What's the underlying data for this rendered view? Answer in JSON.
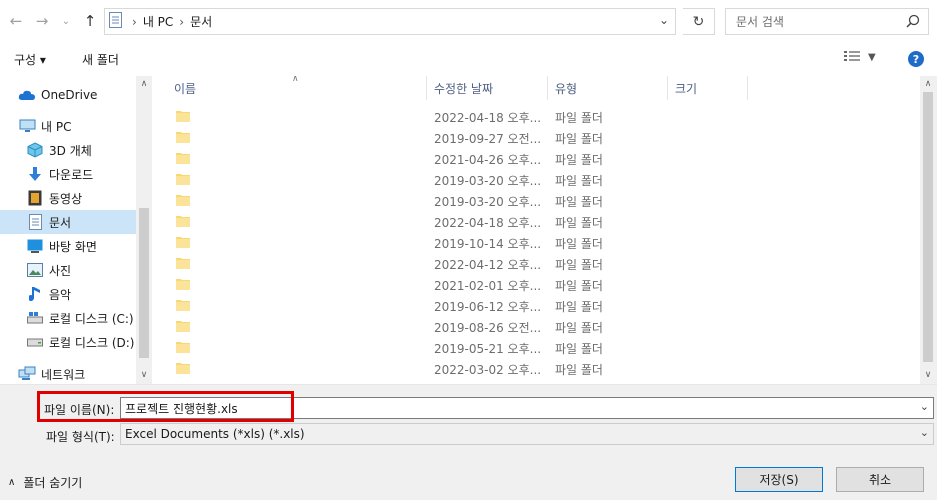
{
  "address": {
    "crumbs": [
      "내 PC",
      "문서"
    ]
  },
  "search": {
    "placeholder": "문서 검색"
  },
  "toolbar": {
    "organize_label": "구성 ▾",
    "new_folder_label": "새 폴더",
    "help_label": "?"
  },
  "navpane": {
    "items": [
      {
        "label": "OneDrive",
        "icon": "cloud-icon"
      },
      {
        "label": "내 PC",
        "icon": "computer-icon"
      },
      {
        "label": "3D 개체",
        "icon": "cube-icon"
      },
      {
        "label": "다운로드",
        "icon": "download-arrow-icon"
      },
      {
        "label": "동영상",
        "icon": "film-icon"
      },
      {
        "label": "문서",
        "icon": "document-icon",
        "selected": true
      },
      {
        "label": "바탕 화면",
        "icon": "desktop-icon"
      },
      {
        "label": "사진",
        "icon": "picture-icon"
      },
      {
        "label": "음악",
        "icon": "music-note-icon"
      },
      {
        "label": "로컬 디스크 (C:)",
        "icon": "drive-icon"
      },
      {
        "label": "로컬 디스크 (D:)",
        "icon": "drive-icon"
      },
      {
        "label": "네트워크",
        "icon": "network-icon"
      }
    ]
  },
  "filelist": {
    "columns": {
      "name": "이름",
      "date": "수정한 날짜",
      "type": "유형",
      "size": "크기"
    },
    "rows": [
      {
        "name": "",
        "date": "2022-04-18 오후...",
        "type": "파일 폴더"
      },
      {
        "name": "",
        "date": "2019-09-27 오전...",
        "type": "파일 폴더"
      },
      {
        "name": "",
        "date": "2021-04-26 오후...",
        "type": "파일 폴더"
      },
      {
        "name": "",
        "date": "2019-03-20 오후...",
        "type": "파일 폴더"
      },
      {
        "name": "",
        "date": "2019-03-20 오후...",
        "type": "파일 폴더"
      },
      {
        "name": "",
        "date": "2022-04-18 오후...",
        "type": "파일 폴더"
      },
      {
        "name": "",
        "date": "2019-10-14 오후...",
        "type": "파일 폴더"
      },
      {
        "name": "",
        "date": "2022-04-12 오후...",
        "type": "파일 폴더"
      },
      {
        "name": "",
        "date": "2021-02-01 오후...",
        "type": "파일 폴더"
      },
      {
        "name": "",
        "date": "2019-06-12 오후...",
        "type": "파일 폴더"
      },
      {
        "name": "",
        "date": "2019-08-26 오전...",
        "type": "파일 폴더"
      },
      {
        "name": "",
        "date": "2019-05-21 오후...",
        "type": "파일 폴더"
      },
      {
        "name": "",
        "date": "2022-03-02 오후...",
        "type": "파일 폴더"
      }
    ]
  },
  "bottom": {
    "filename_label": "파일 이름(N):",
    "filename_value": "프로젝트 진행현황.xls",
    "filetype_label": "파일 형식(T):",
    "filetype_value": "Excel Documents (*xls) (*.xls)",
    "hide_folders_label": "폴더 숨기기",
    "save_label": "저장(S)",
    "cancel_label": "취소"
  },
  "colors": {
    "accent": "#0078d7",
    "selection": "#cce4f7",
    "highlight_box": "#e00000",
    "folder": "#f8d775"
  }
}
